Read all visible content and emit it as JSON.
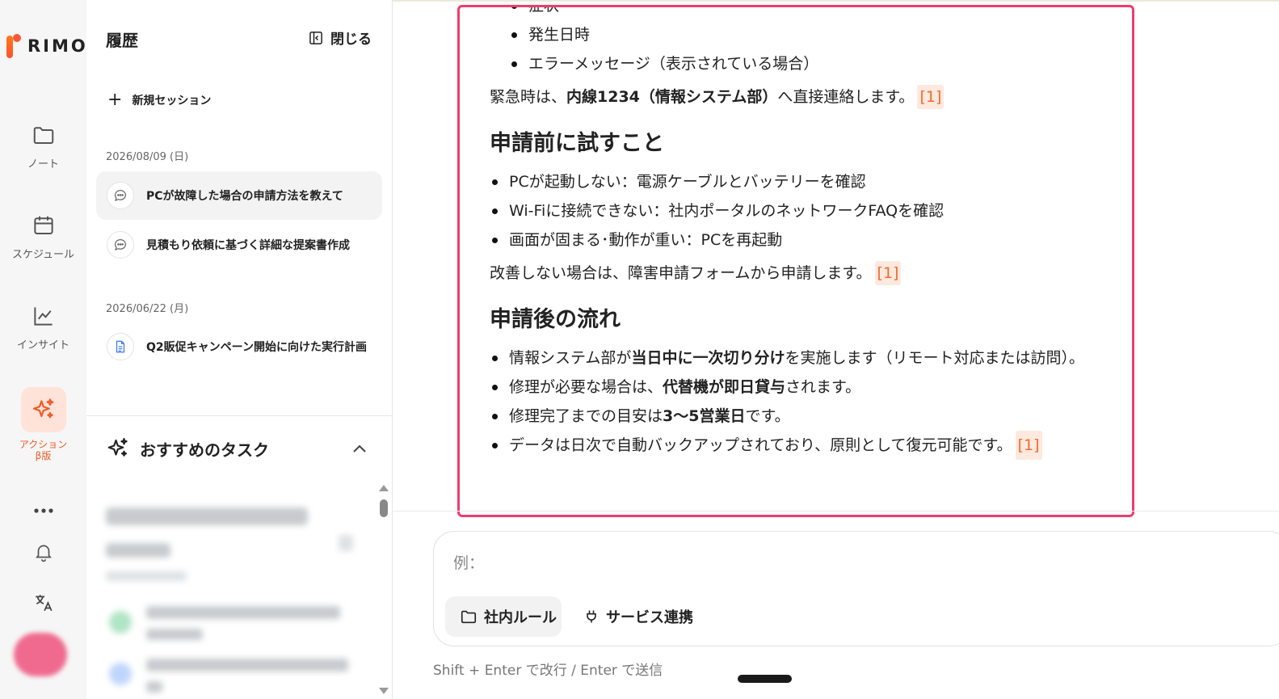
{
  "app": {
    "logo_text": "RIMO",
    "accent": "#f15a24",
    "highlight": "#ee3c6e"
  },
  "rail": {
    "items": [
      {
        "icon": "folder-icon",
        "label": "ノート"
      },
      {
        "icon": "calendar-icon",
        "label": "スケジュール"
      },
      {
        "icon": "chart-line-icon",
        "label": "インサイト"
      },
      {
        "icon": "sparkles-icon",
        "label": "アクション",
        "sublabel": "β版",
        "active": true
      }
    ],
    "more_icon": "more-dots-icon",
    "bell_icon": "bell-icon",
    "translate_icon": "translate-icon"
  },
  "history": {
    "title": "履歴",
    "close_label": "閉じる",
    "new_session_label": "新規セッション",
    "groups": [
      {
        "date": "2026/08/09 (日)",
        "items": [
          {
            "icon": "chat-icon",
            "text": "PCが故障した場合の申請方法を教えて",
            "active": true
          },
          {
            "icon": "chat-icon",
            "text": "見積もり依頼に基づく詳細な提案書作成"
          }
        ]
      },
      {
        "date": "2026/06/22 (月)",
        "items": [
          {
            "icon": "document-icon",
            "text": "Q2販促キャンペーン開始に向けた実行計画"
          }
        ]
      }
    ],
    "recommended_title": "おすすめのタスク"
  },
  "content": {
    "top_list": [
      "症状",
      "発生日時",
      "エラーメッセージ（表示されている場合）"
    ],
    "emergency": {
      "pre": "緊急時は、",
      "bold": "内線1234（情報システム部）",
      "post": "へ直接連絡します。",
      "ref": "[1]"
    },
    "section1": {
      "title": "申請前に試すこと",
      "items": [
        "PCが起動しない：電源ケーブルとバッテリーを確認",
        "Wi-Fiに接続できない：社内ポータルのネットワークFAQを確認",
        "画面が固まる･動作が重い：PCを再起動"
      ],
      "note": "改善しない場合は、障害申請フォームから申請します。",
      "ref": "[1]"
    },
    "section2": {
      "title": "申請後の流れ",
      "item1": {
        "pre": "情報システム部が",
        "bold": "当日中に一次切り分け",
        "post": "を実施します（リモート対応または訪問）。"
      },
      "item2": {
        "pre": "修理が必要な場合は、",
        "bold": "代替機が即日貸与",
        "post": "されます。"
      },
      "item3": {
        "pre": "修理完了までの目安は",
        "bold": "3〜5営業日",
        "post": "です。"
      },
      "item4": {
        "text": "データは日次で自動バックアップされており、原則として復元可能です。",
        "ref": "[1]"
      }
    }
  },
  "composer": {
    "placeholder": "例：",
    "chip_rules": "社内ルール",
    "chip_services": "サービス連携",
    "hint": "Shift + Enter で改行 / Enter で送信"
  }
}
